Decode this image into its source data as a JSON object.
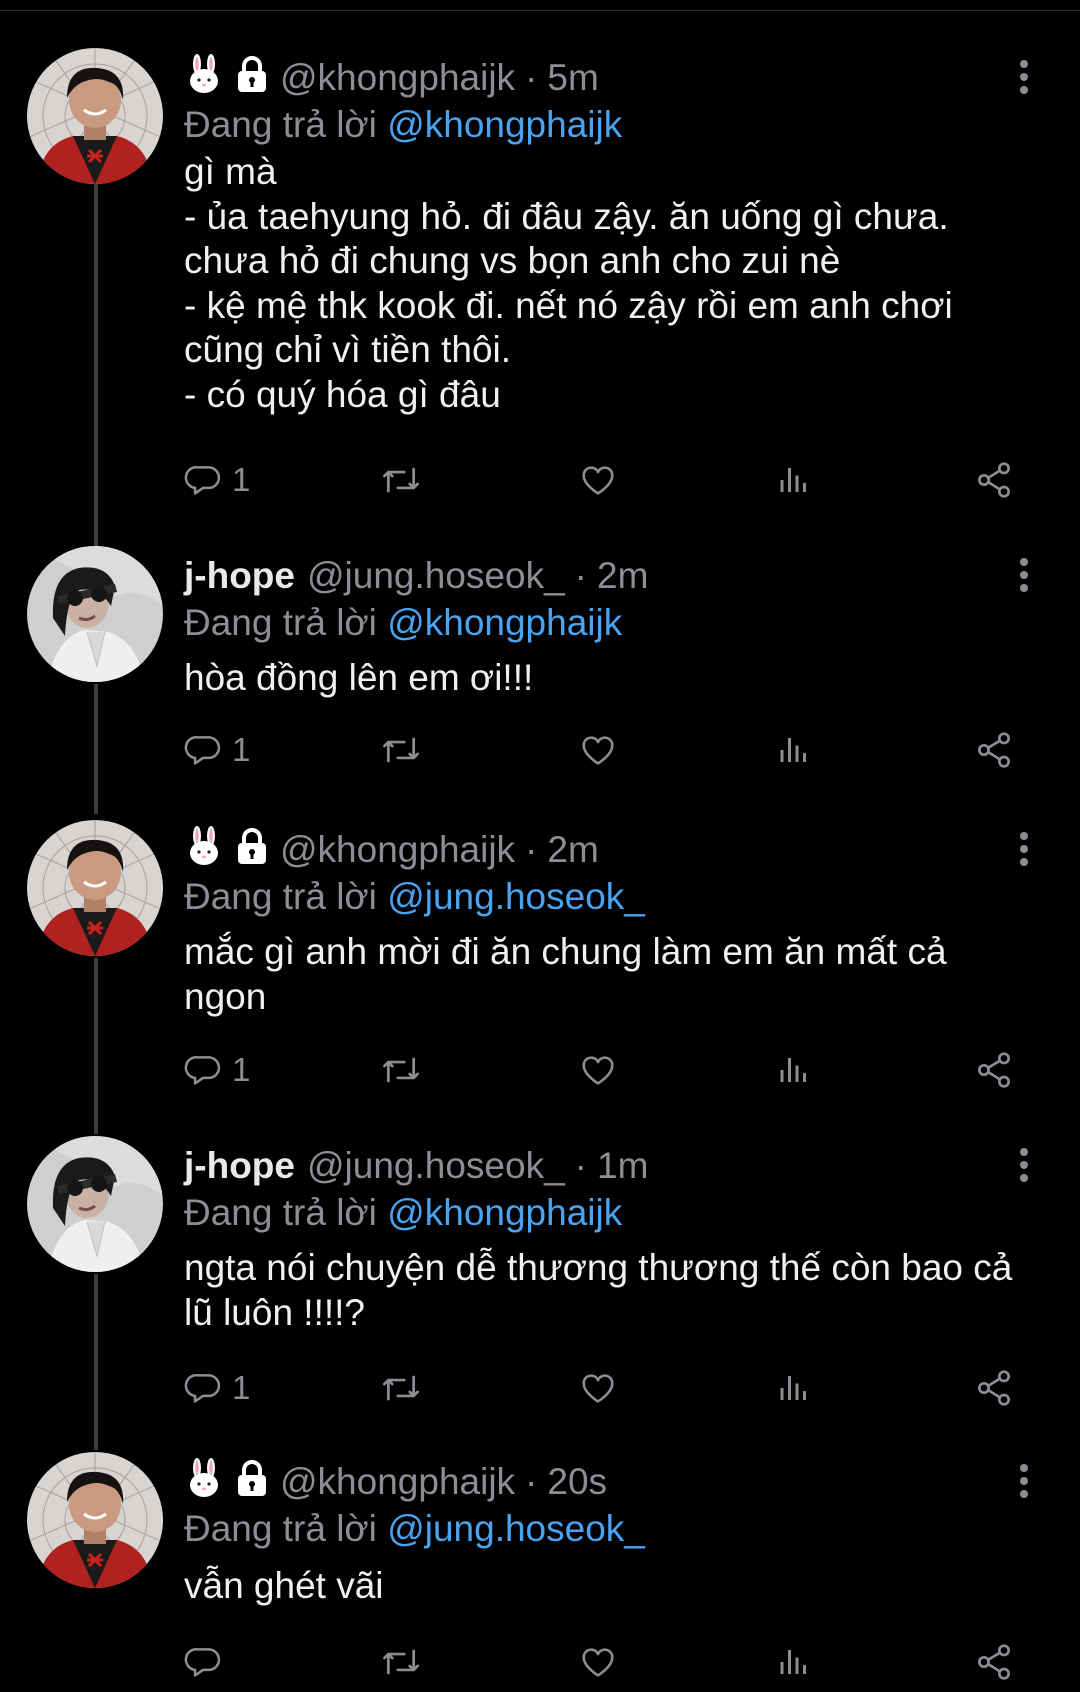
{
  "colors": {
    "background": "#000000",
    "text": "#e7e9ea",
    "muted": "#8b8f95",
    "link": "#4aa3f0"
  },
  "tweets": [
    {
      "author": "khongphaijk",
      "name_emoji": "🐰",
      "lock_icon": "lock-icon",
      "handle": "@khongphaijk",
      "time": "5m",
      "reply_prefix": "Đang trả lời",
      "reply_to": "@khongphaijk",
      "text": "gì mà\n- ủa taehyung hỏ. đi đâu zậy. ăn uống gì chưa.\nchưa hỏ đi chung vs bọn anh cho zui nè\n- kệ mệ thk kook đi. nết nó zậy rồi em anh chơi\ncũng chỉ vì tiền thôi.\n- có quý hóa gì đâu",
      "replies": "1"
    },
    {
      "author": "jhope",
      "name": "j-hope",
      "handle": "@jung.hoseok_",
      "time": "2m",
      "reply_prefix": "Đang trả lời",
      "reply_to": "@khongphaijk",
      "text": "hòa đồng lên em ơi!!!",
      "replies": "1"
    },
    {
      "author": "khongphaijk",
      "name_emoji": "🐰",
      "lock_icon": "lock-icon",
      "handle": "@khongphaijk",
      "time": "2m",
      "reply_prefix": "Đang trả lời",
      "reply_to": "@jung.hoseok_",
      "text": "mắc gì anh mời đi ăn chung làm em ăn mất cả\nngon",
      "replies": "1"
    },
    {
      "author": "jhope",
      "name": "j-hope",
      "handle": "@jung.hoseok_",
      "time": "1m",
      "reply_prefix": "Đang trả lời",
      "reply_to": "@khongphaijk",
      "text": "ngta nói chuyện dễ thương thương thế còn bao cả\nlũ luôn !!!!?",
      "replies": "1"
    },
    {
      "author": "khongphaijk",
      "name_emoji": "🐰",
      "lock_icon": "lock-icon",
      "handle": "@khongphaijk",
      "time": "20s",
      "reply_prefix": "Đang trả lời",
      "reply_to": "@jung.hoseok_",
      "text": "vẫn ghét vãi",
      "replies": ""
    }
  ],
  "action_icons": [
    "reply-icon",
    "retweet-icon",
    "like-icon",
    "views-icon",
    "share-icon"
  ]
}
